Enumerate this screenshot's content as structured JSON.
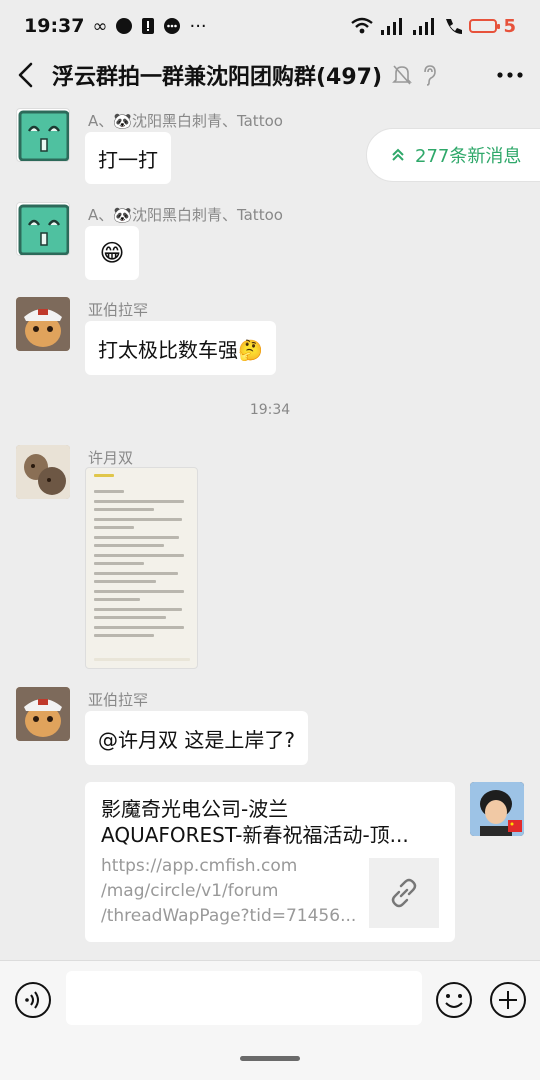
{
  "status_bar": {
    "time": "19:37",
    "battery_level": "5"
  },
  "header": {
    "title": "浮云群拍一群兼沈阳团购群(497)"
  },
  "new_messages": {
    "label": "277条新消息"
  },
  "messages": [
    {
      "sender": "A、🐼沈阳黑白刺青、Tattoo",
      "text": "打一打"
    },
    {
      "sender": "A、🐼沈阳黑白刺青、Tattoo",
      "text": "😁"
    },
    {
      "sender": "亚伯拉罕",
      "text": "打太极比数车强🤔"
    },
    {
      "sender": "许月双",
      "image": "phone-note-screenshot"
    },
    {
      "sender": "亚伯拉罕",
      "text": "@许月双  这是上岸了?"
    }
  ],
  "timestamp": "19:34",
  "link_card": {
    "title_line1": "影魔奇光电公司-波兰",
    "title_line2": "AQUAFOREST-新春祝福活动-顶...",
    "url_line1": "https://app.cmfish.com",
    "url_line2": "/mag/circle/v1/forum",
    "url_line3": "/threadWapPage?tid=71456..."
  },
  "colors": {
    "accent_green": "#2fa86a",
    "battery_red": "#e7523b",
    "background": "#ededed"
  }
}
